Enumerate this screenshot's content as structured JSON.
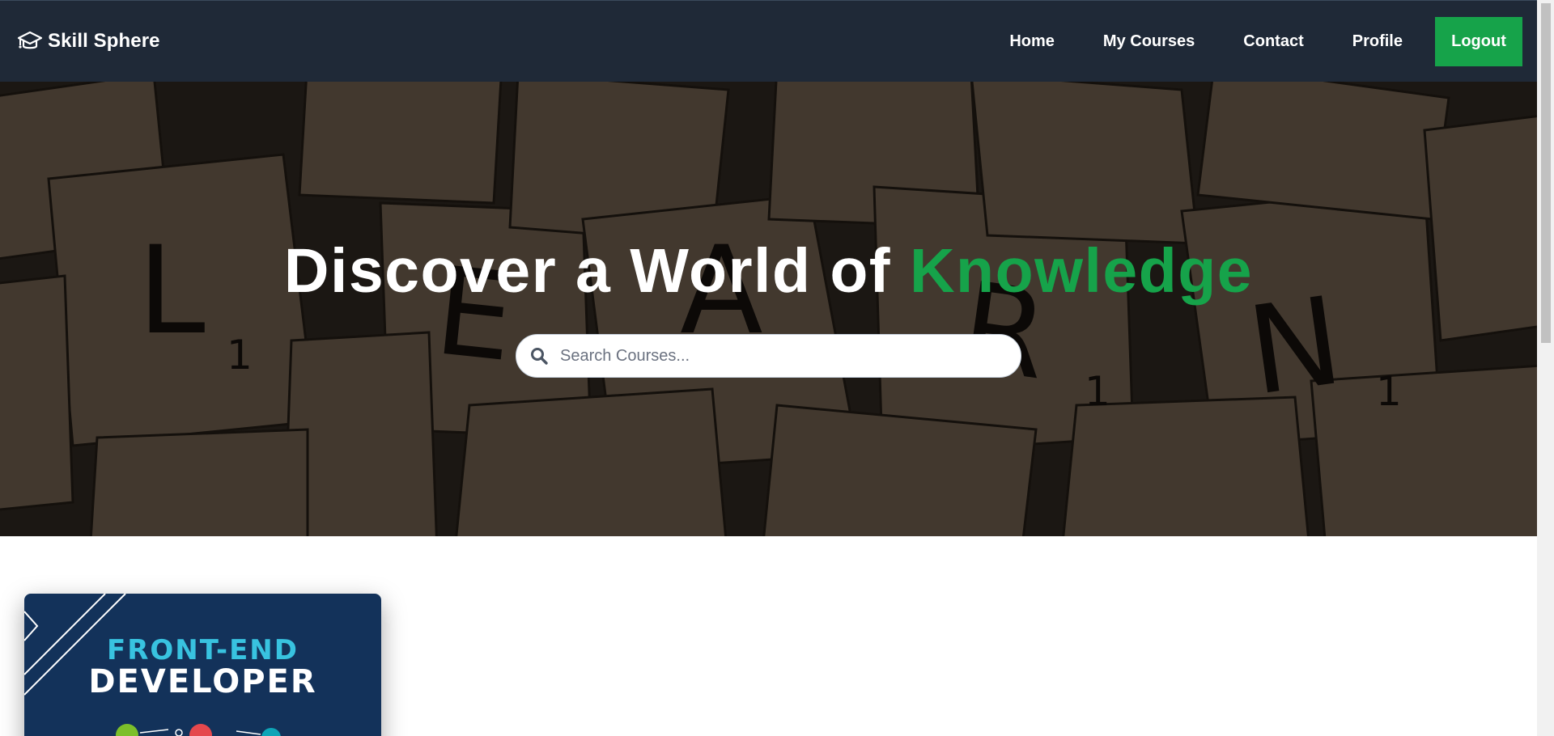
{
  "brand": {
    "name": "Skill Sphere",
    "icon": "graduation-cap-icon"
  },
  "nav": {
    "links": [
      {
        "label": "Home"
      },
      {
        "label": "My Courses"
      },
      {
        "label": "Contact"
      },
      {
        "label": "Profile"
      }
    ],
    "logout_label": "Logout"
  },
  "hero": {
    "title_main": "Discover a World of ",
    "title_accent": "Knowledge",
    "background": "LEARN scrabble tiles photo",
    "search_placeholder": "Search Courses..."
  },
  "course_card": {
    "title_top": "FRONT-END",
    "title_bottom": "DEVELOPER"
  },
  "colors": {
    "navbar_bg": "#1f2937",
    "accent_green": "#16a34a",
    "card_bg": "#13325a",
    "card_accent": "#38c3e0"
  }
}
